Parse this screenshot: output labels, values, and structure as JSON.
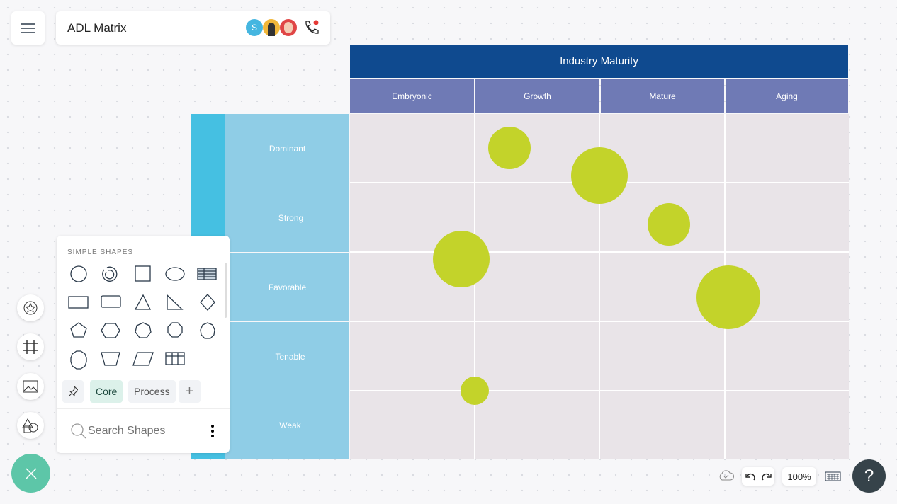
{
  "header": {
    "title": "ADL Matrix",
    "avatar_initial": "S"
  },
  "matrix": {
    "title": "Industry Maturity",
    "columns": [
      "Embryonic",
      "Growth",
      "Mature",
      "Aging"
    ],
    "rows": [
      "Dominant",
      "Strong",
      "Favorable",
      "Tenable",
      "Weak"
    ],
    "bubble_color": "#c3d32a"
  },
  "shapes_panel": {
    "section_title": "SIMPLE SHAPES",
    "tabs": [
      "Core",
      "Process"
    ],
    "search_placeholder": "Search Shapes"
  },
  "footer": {
    "zoom": "100%"
  },
  "colors": {
    "header": "#0f4a8f",
    "column_header": "#6f7ab5",
    "row_label": "#8fcde6",
    "row_strip": "#45c0e2",
    "fab": "#5dc6a8",
    "help": "#36434a"
  }
}
